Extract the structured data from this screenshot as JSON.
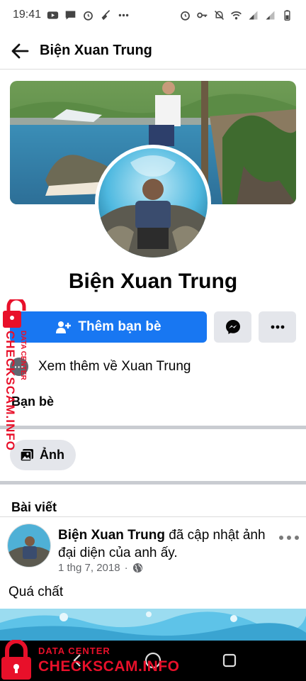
{
  "status_bar": {
    "time": "19:41",
    "icons_left": [
      "youtube-icon",
      "message-icon",
      "alarm-icon",
      "broom-icon",
      "more-dots-icon"
    ],
    "icons_right": [
      "alarm-icon",
      "key-icon",
      "mute-icon",
      "wifi-icon",
      "signal-icon",
      "signal-icon",
      "battery-icon"
    ]
  },
  "header": {
    "title": "Biện Xuan Trung"
  },
  "profile": {
    "name": "Biện Xuan Trung",
    "add_friend_label": "Thêm bạn bè",
    "about_label": "Xem thêm về Xuan Trung",
    "friends_label": "Bạn bè",
    "photos_label": "Ảnh"
  },
  "posts": {
    "section_title": "Bài viết",
    "items": [
      {
        "author": "Biện Xuan Trung",
        "action": " đã cập nhật ảnh đại diện của anh ấy.",
        "date": "1 thg 7, 2018",
        "separator": "·",
        "text": "Quá chất"
      }
    ]
  },
  "watermark": {
    "small": "DATA CENTER",
    "big": "CHECKSCAM.INFO"
  },
  "colors": {
    "accent": "#1877f2",
    "watermark": "#e8102a",
    "button_gray": "#e4e6eb"
  }
}
